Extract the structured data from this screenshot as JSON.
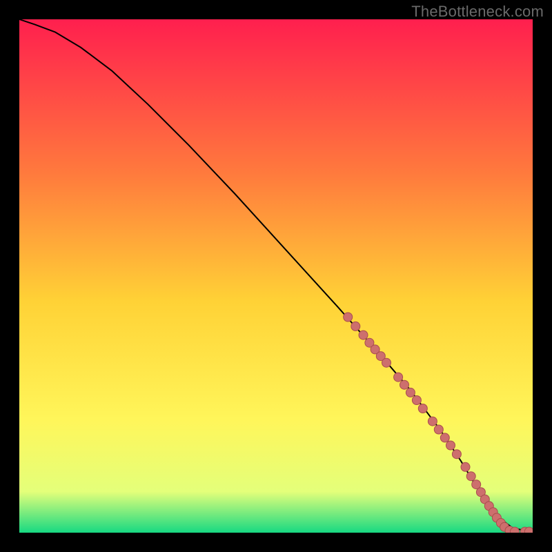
{
  "watermark": "TheBottleneck.com",
  "colors": {
    "gradient_top": "#ff1f4e",
    "gradient_q1": "#ff7a3d",
    "gradient_mid": "#ffd236",
    "gradient_q3": "#fff65a",
    "gradient_near_bottom": "#e4ff7a",
    "gradient_bottom": "#17d982",
    "line": "#000000",
    "marker_fill": "#cd6f6d",
    "marker_stroke": "#a94d4d",
    "frame": "#000000"
  },
  "chart_data": {
    "type": "line",
    "title": "",
    "xlabel": "",
    "ylabel": "",
    "xlim": [
      0,
      100
    ],
    "ylim": [
      0,
      100
    ],
    "series": [
      {
        "name": "curve",
        "x": [
          0,
          3,
          7,
          12,
          18,
          25,
          33,
          42,
          52,
          62,
          70,
          76,
          82,
          86,
          89,
          92,
          94,
          96,
          98,
          100
        ],
        "y": [
          100,
          99,
          97.5,
          94.5,
          90,
          83.5,
          75.5,
          66,
          55,
          44,
          35,
          28,
          20,
          14,
          9,
          5,
          2.5,
          1,
          0.5,
          0.3
        ]
      }
    ],
    "markers": [
      {
        "x": 64,
        "y": 42
      },
      {
        "x": 65.5,
        "y": 40.2
      },
      {
        "x": 67,
        "y": 38.5
      },
      {
        "x": 68.2,
        "y": 37
      },
      {
        "x": 69.3,
        "y": 35.7
      },
      {
        "x": 70.4,
        "y": 34.4
      },
      {
        "x": 71.5,
        "y": 33.1
      },
      {
        "x": 73.8,
        "y": 30.3
      },
      {
        "x": 75,
        "y": 28.8
      },
      {
        "x": 76.2,
        "y": 27.3
      },
      {
        "x": 77.4,
        "y": 25.8
      },
      {
        "x": 78.6,
        "y": 24.2
      },
      {
        "x": 80.5,
        "y": 21.7
      },
      {
        "x": 81.7,
        "y": 20.1
      },
      {
        "x": 82.9,
        "y": 18.5
      },
      {
        "x": 84,
        "y": 17
      },
      {
        "x": 85.2,
        "y": 15.3
      },
      {
        "x": 86.9,
        "y": 12.8
      },
      {
        "x": 88,
        "y": 11
      },
      {
        "x": 89,
        "y": 9.4
      },
      {
        "x": 89.9,
        "y": 7.9
      },
      {
        "x": 90.7,
        "y": 6.5
      },
      {
        "x": 91.5,
        "y": 5.2
      },
      {
        "x": 92.3,
        "y": 4
      },
      {
        "x": 93,
        "y": 2.9
      },
      {
        "x": 93.8,
        "y": 1.9
      },
      {
        "x": 94.5,
        "y": 1.1
      },
      {
        "x": 95.5,
        "y": 0.4
      },
      {
        "x": 96.5,
        "y": 0.2
      },
      {
        "x": 98.5,
        "y": 0.2
      },
      {
        "x": 99.3,
        "y": 0.2
      }
    ]
  }
}
